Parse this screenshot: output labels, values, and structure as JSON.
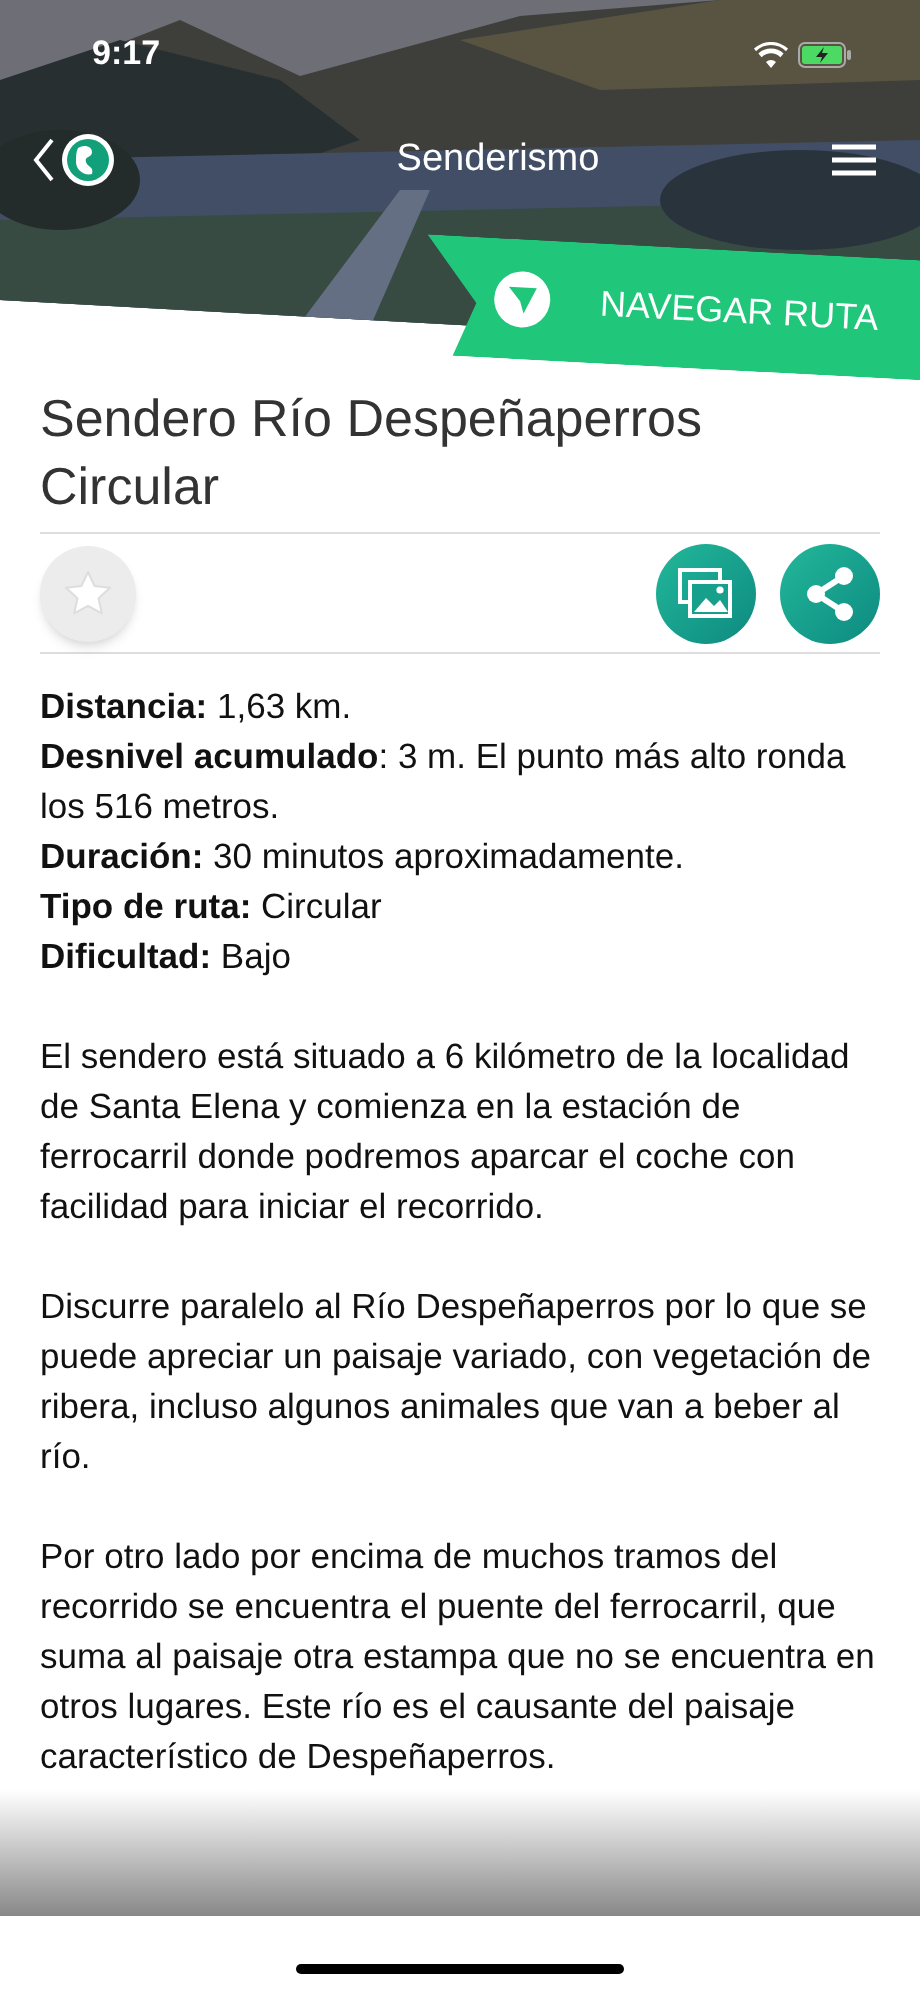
{
  "status_bar": {
    "time": "9:17"
  },
  "nav": {
    "title": "Senderismo"
  },
  "navigate_button": {
    "label": "NAVEGAR RUTA"
  },
  "route": {
    "title": "Sendero Río Despeñaperros Circular",
    "favorite": false
  },
  "facts": [
    "**Distancia:** 1,63 km.",
    "**Desnivel acumulado**: 3 m. El punto más alto ronda los 516 metros.",
    "**Duración:** 30 minutos aproximadamente.",
    "**Tipo de ruta:** Circular",
    "**Dificultad:** Bajo"
  ],
  "paragraphs": [
    "El sendero está situado a 6 kilómetro de la localidad de Santa Elena y comienza en la estación de ferrocarril donde podremos aparcar el coche con facilidad para iniciar el recorrido.",
    "Discurre paralelo al Río Despeñaperros por lo que se puede apreciar un paisaje variado, con vegetación de ribera, incluso algunos animales que van a beber al río.",
    "Por otro lado por encima de muchos tramos del recorrido se encuentra el puente del ferrocarril, que suma al paisaje otra estampa que no se encuentra en otros lugares. Este río es el causante del paisaje característico de Despeñaperros."
  ]
}
